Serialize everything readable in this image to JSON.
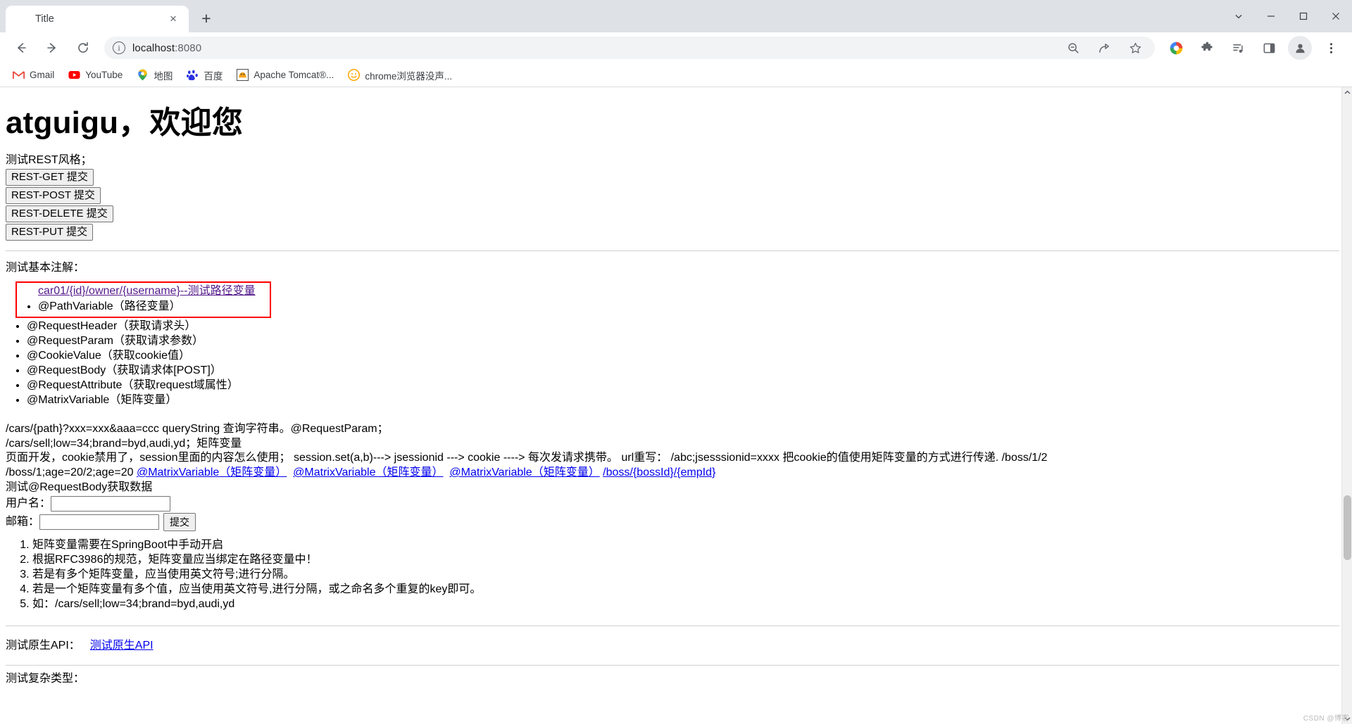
{
  "browser": {
    "tab": {
      "title": "Title",
      "favicon": "globe-icon",
      "close": "×"
    },
    "new_tab": "+",
    "window_controls": {
      "chevron": "⌄",
      "minimize": "—",
      "maximize": "☐",
      "close": "✕"
    },
    "nav": {
      "back": "←",
      "forward": "→",
      "reload": "⟳"
    },
    "omnibox": {
      "info_icon": "i",
      "url_host": "localhost",
      "url_port": ":8080",
      "full_url": "localhost:8080"
    },
    "toolbar_icons": [
      {
        "name": "zoom-out-icon",
        "glyph": "⊖"
      },
      {
        "name": "share-icon",
        "glyph": "⤴"
      },
      {
        "name": "bookmark-star-icon",
        "glyph": "☆"
      },
      {
        "name": "google-lens-icon",
        "glyph": "●"
      },
      {
        "name": "extensions-puzzle-icon",
        "glyph": "✦"
      },
      {
        "name": "media-playlist-icon",
        "glyph": "≡"
      },
      {
        "name": "side-panel-icon",
        "glyph": "▣"
      },
      {
        "name": "profile-avatar-icon",
        "glyph": "●"
      },
      {
        "name": "chrome-menu-icon",
        "glyph": "⋮"
      }
    ],
    "bookmarks": [
      {
        "label": "Gmail",
        "icon": "gmail-icon",
        "glyph": "M",
        "color": "#ea4335"
      },
      {
        "label": "YouTube",
        "icon": "youtube-icon",
        "glyph": "▶",
        "color": "#ff0000"
      },
      {
        "label": "地图",
        "icon": "google-maps-icon",
        "glyph": "●",
        "color": "#34a853"
      },
      {
        "label": "百度",
        "icon": "baidu-icon",
        "glyph": "熊",
        "color": "#2932e1"
      },
      {
        "label": "Apache Tomcat®...",
        "icon": "tomcat-icon",
        "glyph": "ὃ1",
        "color": "#f8a31b"
      },
      {
        "label": "chrome浏览器没声...",
        "icon": "chrome-sound-icon",
        "glyph": "☺",
        "color": "#ffa500"
      }
    ]
  },
  "page": {
    "heading": "atguigu，欢迎您",
    "rest_section_label": "测试REST风格；",
    "rest_buttons": [
      "REST-GET 提交",
      "REST-POST 提交",
      "REST-DELETE 提交",
      "REST-PUT 提交"
    ],
    "anno_section_label": "测试基本注解：",
    "path_variable_link": "car01/{id}/owner/{username}--测试路径变量",
    "annotations": [
      "@PathVariable（路径变量）",
      "@RequestHeader（获取请求头）",
      "@RequestParam（获取请求参数）",
      "@CookieValue（获取cookie值）",
      "@RequestBody（获取请求体[POST]）",
      "@RequestAttribute（获取request域属性）",
      "@MatrixVariable（矩阵变量）"
    ],
    "notes": [
      "/cars/{path}?xxx=xxx&aaa=ccc queryString 查询字符串。@RequestParam；",
      "/cars/sell;low=34;brand=byd,audi,yd；矩阵变量"
    ],
    "session_paragraph": "页面开发，cookie禁用了，session里面的内容怎么使用；  session.set(a,b)---> jsessionid ---> cookie ----> 每次发请求携带。 url重写： /abc;jsesssionid=xxxx 把cookie的值使用矩阵变量的方式进行传递. /boss/1/2",
    "matrix_line_prefix": "/boss/1;age=20/2;age=20",
    "matrix_links": [
      "@MatrixVariable（矩阵变量）",
      "@MatrixVariable（矩阵变量）",
      "@MatrixVariable（矩阵变量）",
      "/boss/{bossId}/{empId}"
    ],
    "requestbody_label": "测试@RequestBody获取数据",
    "form": {
      "username_label": "用户名：",
      "username_value": "",
      "username_placeholder": "",
      "email_label": "邮箱：",
      "email_value": "",
      "email_placeholder": "",
      "submit_label": "提交"
    },
    "matrix_rules": [
      "矩阵变量需要在SpringBoot中手动开启",
      "根据RFC3986的规范，矩阵变量应当绑定在路径变量中！",
      "若是有多个矩阵变量，应当使用英文符号;进行分隔。",
      "若是一个矩阵变量有多个值，应当使用英文符号,进行分隔，或之命名多个重复的key即可。",
      "如：/cars/sell;low=34;brand=byd,audi,yd"
    ],
    "native_api_label": "测试原生API：",
    "native_api_link": "测试原生API",
    "cut_off_text": "测试复杂类型："
  },
  "watermark": "CSDN @博客"
}
